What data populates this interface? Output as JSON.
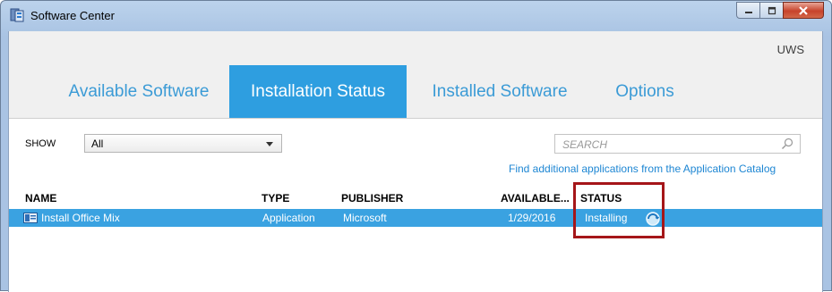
{
  "window": {
    "title": "Software Center",
    "app_icon": "software-center-icon"
  },
  "header": {
    "user": "UWS"
  },
  "tabs": [
    {
      "label": "Available Software",
      "active": false
    },
    {
      "label": "Installation Status",
      "active": true
    },
    {
      "label": "Installed Software",
      "active": false
    },
    {
      "label": "Options",
      "active": false
    }
  ],
  "filter": {
    "show_label": "SHOW",
    "show_value": "All"
  },
  "search": {
    "placeholder": "SEARCH"
  },
  "catalog_link": "Find additional applications from the Application Catalog",
  "columns": {
    "name": "NAME",
    "type": "TYPE",
    "publisher": "PUBLISHER",
    "available": "AVAILABLE...",
    "status": "STATUS"
  },
  "rows": [
    {
      "name": "Install Office Mix",
      "type": "Application",
      "publisher": "Microsoft",
      "available": "1/29/2016",
      "status": "Installing"
    }
  ],
  "colors": {
    "accent": "#2e9ee0",
    "selected_row": "#3aa2e1",
    "tab_text": "#3b9bd6",
    "highlight": "#a51619",
    "link": "#1d86d3"
  }
}
